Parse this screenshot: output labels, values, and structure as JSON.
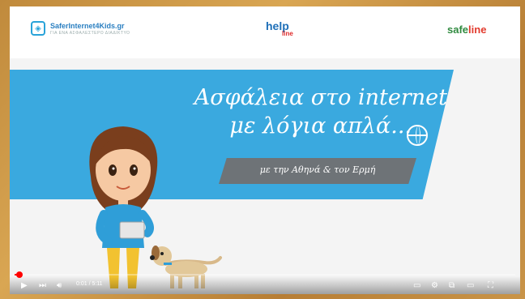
{
  "logos": {
    "left_name": "SaferInternet4Kids.gr",
    "left_tag": "ΓΙΑ ΕΝΑ ΑΣΦΑΛΕΣΤΕΡΟ ΔΙΑΔΙΚΤΥΟ",
    "help_main": "help",
    "help_sub": "line",
    "safe_main": "safe",
    "safe_accent": "line"
  },
  "title": {
    "line1": "Ασφάλεια στο internet",
    "line2": "με λόγια απλά..."
  },
  "subtitle": "με την Αθηνά & τον Ερμή",
  "player": {
    "time": "0:01 / 5:11",
    "progress": 0.006
  },
  "colors": {
    "banner": "#3aa9df",
    "subtitle_band": "#6e7377",
    "progress": "#ff0000"
  }
}
